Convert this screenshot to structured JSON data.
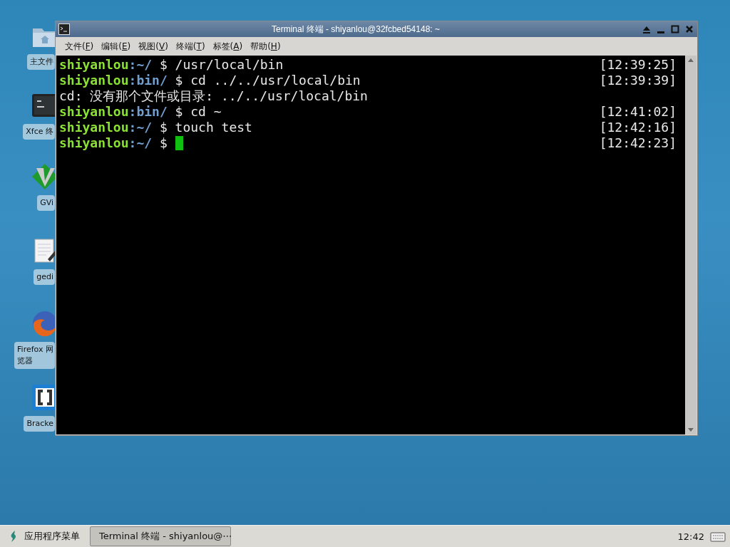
{
  "desktop_icons": [
    {
      "kind": "folder",
      "label_lines": [
        "主文件"
      ]
    },
    {
      "kind": "terminal",
      "label_lines": [
        "Xfce 终"
      ]
    },
    {
      "kind": "vim",
      "label_lines": [
        "GVi"
      ]
    },
    {
      "kind": "editor",
      "label_lines": [
        "gedi"
      ]
    },
    {
      "kind": "browser",
      "label_lines": [
        "Firefox 网",
        "览器"
      ]
    },
    {
      "kind": "brackets",
      "label_lines": [
        "Bracke"
      ]
    }
  ],
  "window": {
    "title": "Terminal 终端 - shiyanlou@32fcbed54148: ~",
    "menu": [
      {
        "before": "文件(",
        "mnemonic": "F",
        "after": ")"
      },
      {
        "before": "编辑(",
        "mnemonic": "E",
        "after": ")"
      },
      {
        "before": "视图(",
        "mnemonic": "V",
        "after": ")"
      },
      {
        "before": "终端(",
        "mnemonic": "T",
        "after": ")"
      },
      {
        "before": "标签(",
        "mnemonic": "A",
        "after": ")"
      },
      {
        "before": "帮助(",
        "mnemonic": "H",
        "after": ")"
      }
    ],
    "lines": [
      {
        "kind": "prompt",
        "user": "shiyanlou",
        "path": ":~/",
        "command": " $ /usr/local/bin",
        "time": "[12:39:25]",
        "cursor": false
      },
      {
        "kind": "prompt",
        "user": "shiyanlou",
        "path": ":bin/",
        "command": " $ cd ../../usr/local/bin",
        "time": "[12:39:39]",
        "cursor": false
      },
      {
        "kind": "output",
        "text": "cd: 没有那个文件或目录: ../../usr/local/bin"
      },
      {
        "kind": "prompt",
        "user": "shiyanlou",
        "path": ":bin/",
        "command": " $ cd ~",
        "time": "[12:41:02]",
        "cursor": false
      },
      {
        "kind": "prompt",
        "user": "shiyanlou",
        "path": ":~/",
        "command": " $ touch test",
        "time": "[12:42:16]",
        "cursor": false
      },
      {
        "kind": "prompt",
        "user": "shiyanlou",
        "path": ":~/",
        "command": " $ ",
        "time": "[12:42:23]",
        "cursor": true
      }
    ]
  },
  "taskbar": {
    "menu_label": "应用程序菜单",
    "tasks": [
      {
        "label": "Terminal 终端 - shiyanlou@⋯",
        "selected": true
      }
    ],
    "clock": "12:42"
  }
}
